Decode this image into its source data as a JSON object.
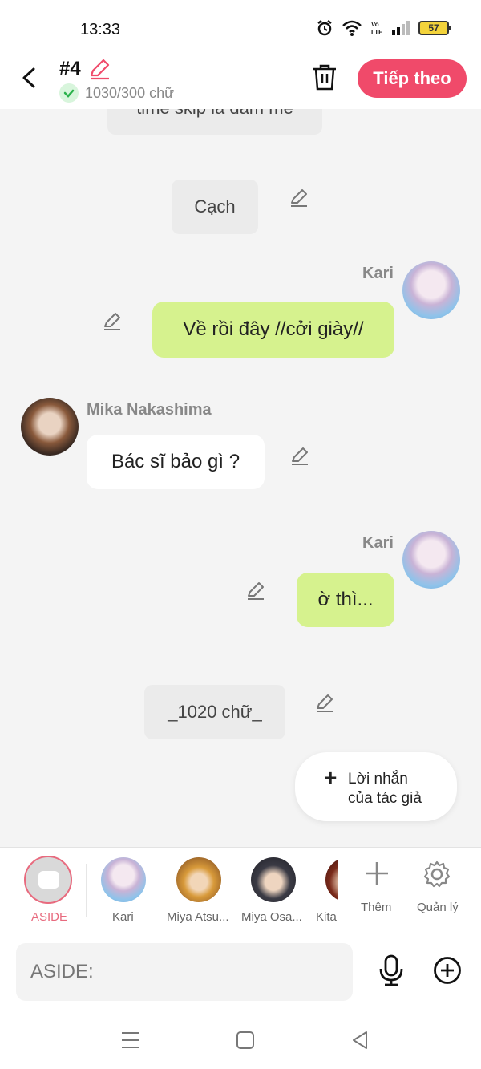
{
  "status": {
    "time": "13:33",
    "battery": "57"
  },
  "header": {
    "chapter": "#4",
    "word_count": "1030/300 chữ",
    "next_label": "Tiếp theo"
  },
  "chat": {
    "cut_narration": "time skip là đắm mê",
    "messages": [
      {
        "type": "narration",
        "text": "Cạch"
      },
      {
        "type": "right",
        "speaker": "Kari",
        "text": "Về rồi đây //cởi giày//"
      },
      {
        "type": "left",
        "speaker": "Mika Nakashima",
        "text": "Bác sĩ bảo gì ?"
      },
      {
        "type": "right",
        "speaker": "Kari",
        "text": "ờ thì..."
      },
      {
        "type": "narration",
        "text": "_1020 chữ_"
      }
    ],
    "author_note": {
      "line1": "Lời nhắn",
      "line2": "của tác giả"
    }
  },
  "characters": [
    {
      "label": "ASIDE"
    },
    {
      "label": "Kari"
    },
    {
      "label": "Miya Atsu..."
    },
    {
      "label": "Miya Osa..."
    },
    {
      "label": "Kita"
    }
  ],
  "char_actions": {
    "add": "Thêm",
    "manage": "Quản lý"
  },
  "input": {
    "placeholder": "ASIDE:"
  },
  "colors": {
    "accent": "#f04a6a",
    "bubble_green": "#d6f28e",
    "aside_red": "#e86a7e"
  }
}
